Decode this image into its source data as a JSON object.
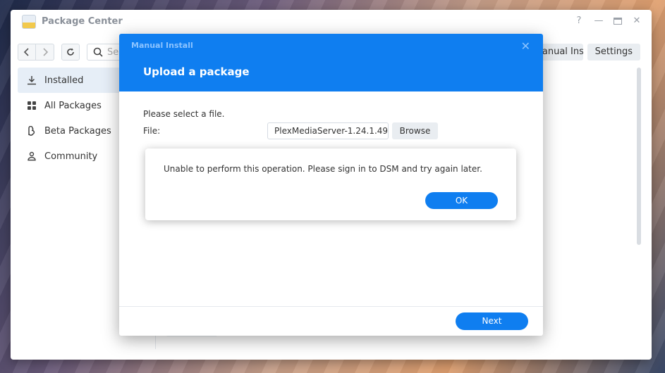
{
  "window": {
    "title": "Package Center",
    "controls": {
      "help": "?",
      "minimize": "—",
      "close": "✕"
    }
  },
  "toolbar": {
    "search_placeholder": "Search",
    "manual_install": "Manual Install",
    "settings": "Settings"
  },
  "sidebar": {
    "items": [
      {
        "label": "Installed",
        "icon": "download-icon",
        "active": true
      },
      {
        "label": "All Packages",
        "icon": "grid-icon",
        "active": false
      },
      {
        "label": "Beta Packages",
        "icon": "beta-icon",
        "active": false
      },
      {
        "label": "Community",
        "icon": "community-icon",
        "active": false
      }
    ]
  },
  "modal": {
    "small_title": "Manual Install",
    "title": "Upload a package",
    "close": "✕",
    "select_prompt": "Please select a file.",
    "file_label": "File:",
    "file_value": "PlexMediaServer-1.24.1.49",
    "browse": "Browse",
    "next": "Next"
  },
  "alert": {
    "message": "Unable to perform this operation. Please sign in to DSM and try again later.",
    "ok": "OK"
  },
  "colors": {
    "accent": "#0f7ef0",
    "sidebar_active": "#e6eef7",
    "button_gray": "#e9edf1"
  }
}
